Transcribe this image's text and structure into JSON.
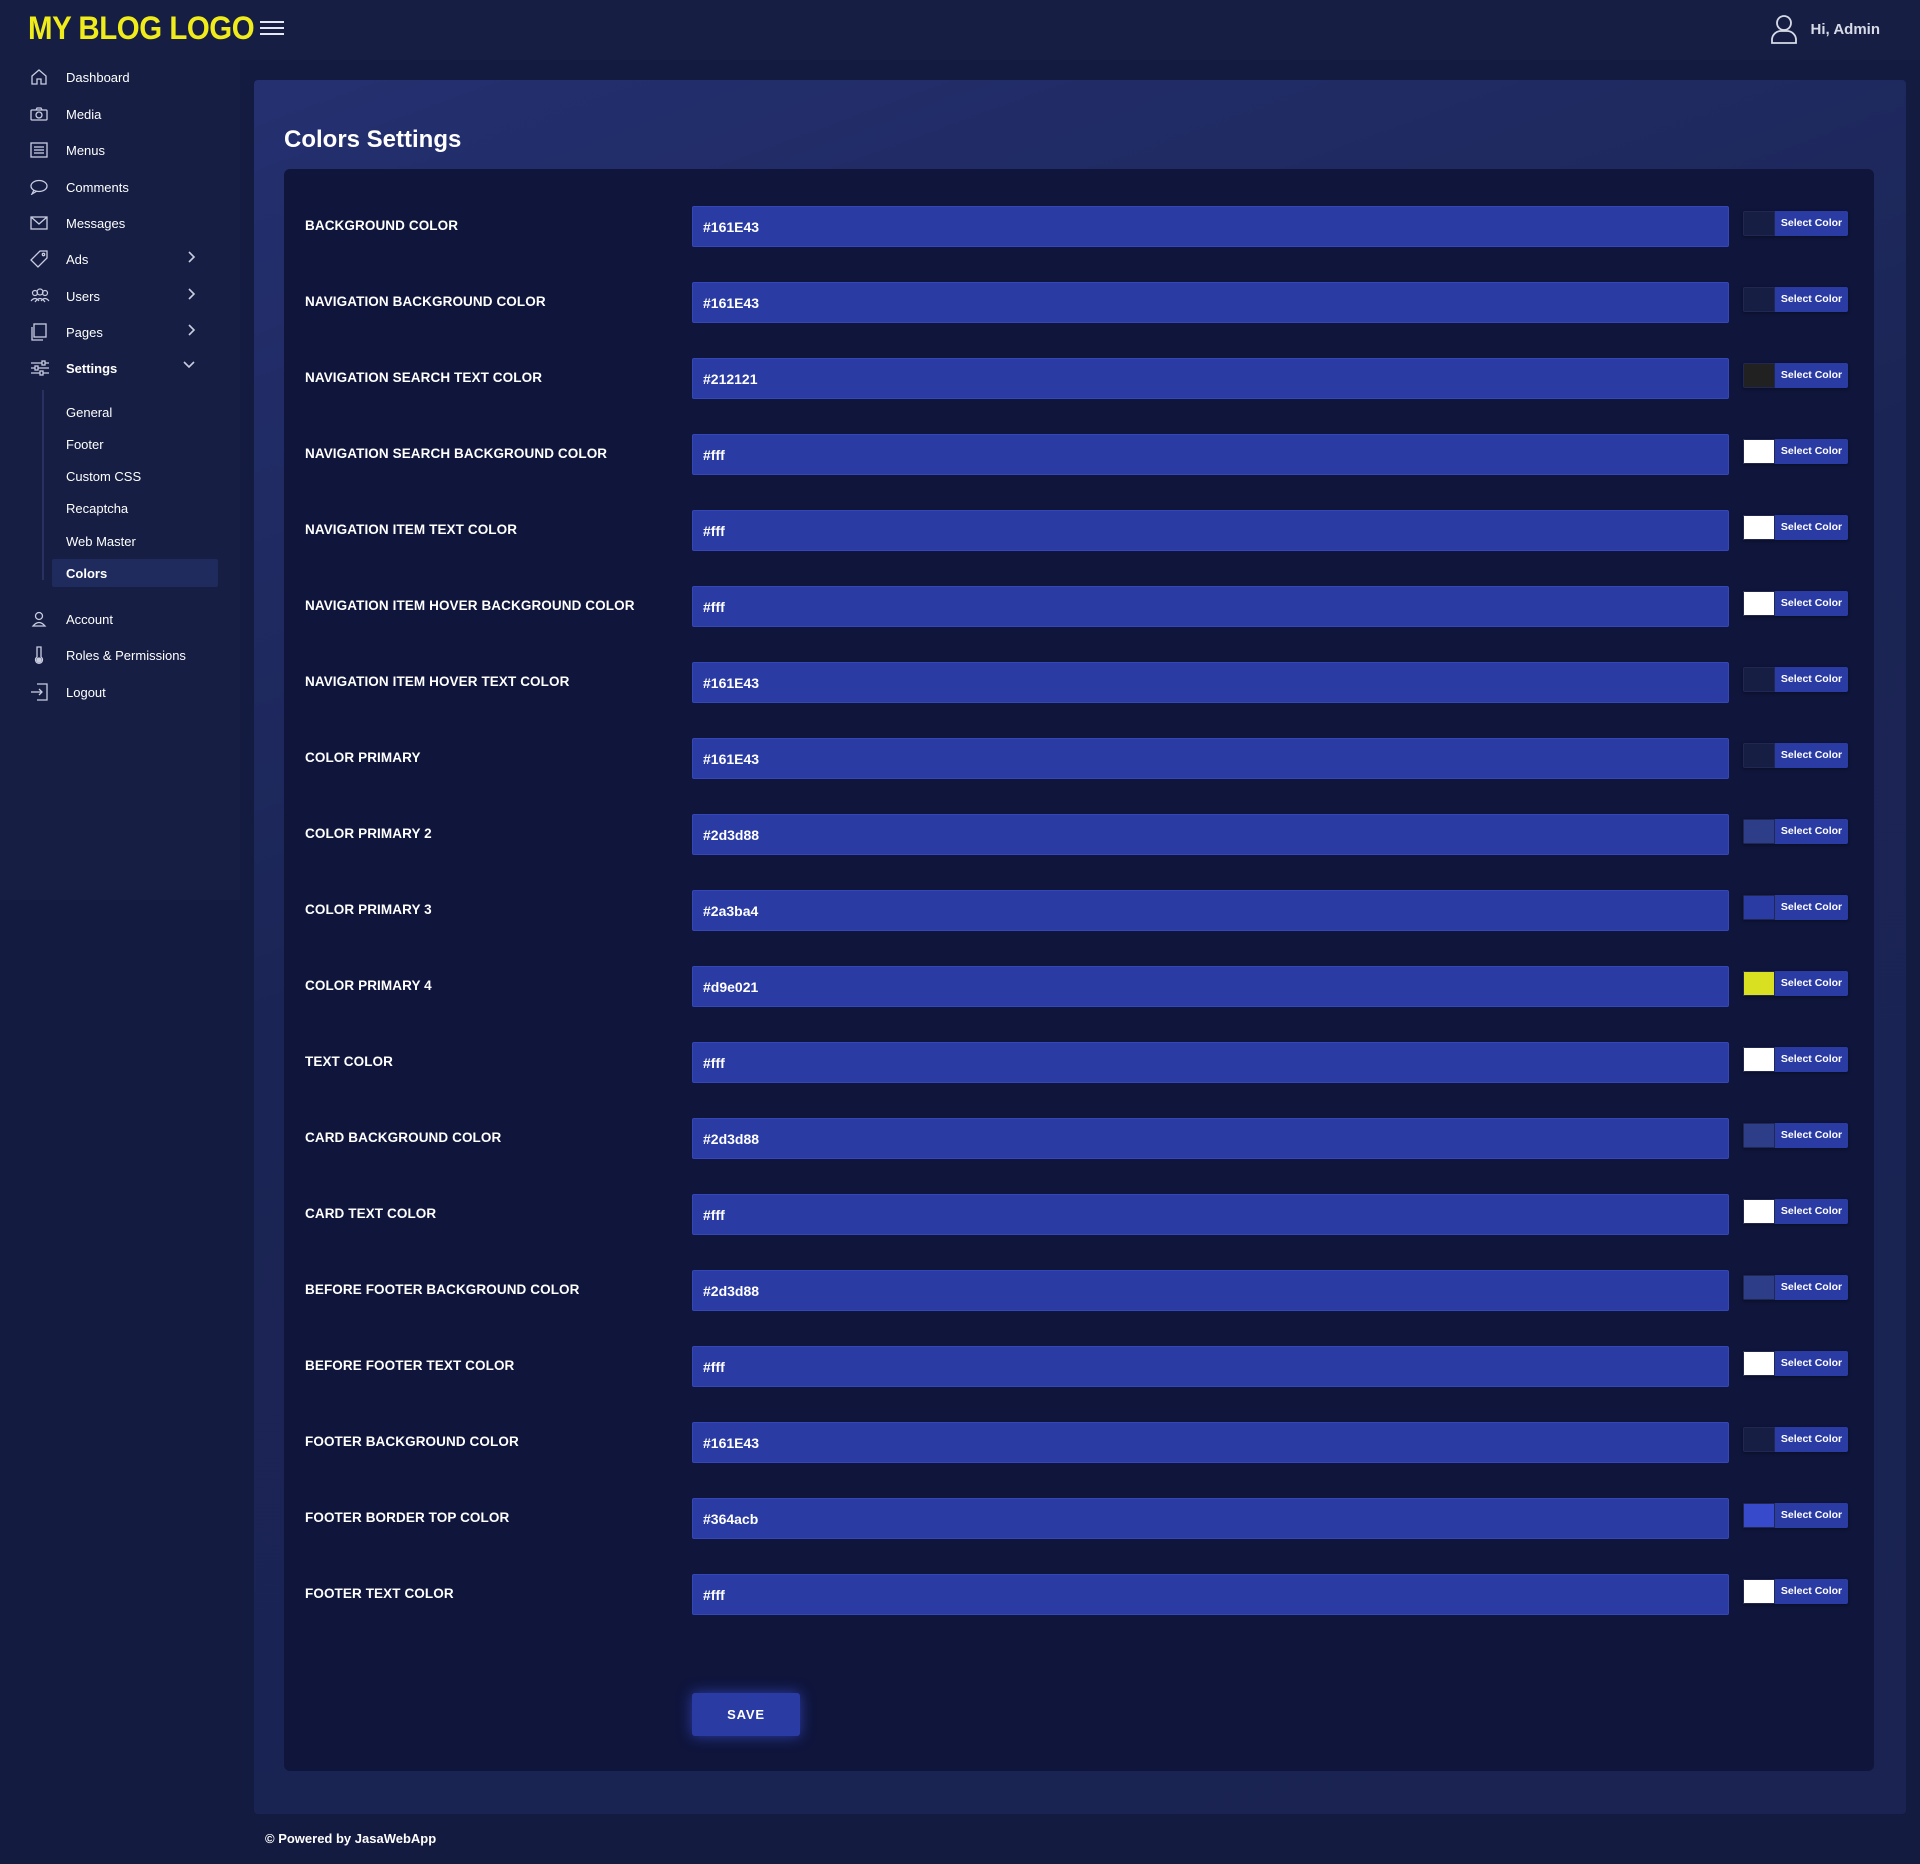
{
  "header": {
    "logo_text": "MY BLOG LOGO",
    "user_greeting": "Hi, Admin",
    "menu_icon": "hamburger-icon",
    "user_icon": "user-icon"
  },
  "sidebar": {
    "items": [
      {
        "label": "Dashboard",
        "icon": "home-icon"
      },
      {
        "label": "Media",
        "icon": "camera-icon"
      },
      {
        "label": "Menus",
        "icon": "list-icon"
      },
      {
        "label": "Comments",
        "icon": "comment-icon"
      },
      {
        "label": "Messages",
        "icon": "mail-icon"
      },
      {
        "label": "Ads",
        "icon": "tag-icon",
        "has_children": true
      },
      {
        "label": "Users",
        "icon": "users-icon",
        "has_children": true
      },
      {
        "label": "Pages",
        "icon": "pages-icon",
        "has_children": true
      },
      {
        "label": "Settings",
        "icon": "sliders-icon",
        "expanded": true
      }
    ],
    "settings_submenu": [
      "General",
      "Footer",
      "Custom CSS",
      "Recaptcha",
      "Web Master",
      "Colors"
    ],
    "active_submenu": "Colors",
    "bottom_items": [
      {
        "label": "Account",
        "icon": "account-icon"
      },
      {
        "label": "Roles & Permissions",
        "icon": "thermometer-icon"
      },
      {
        "label": "Logout",
        "icon": "logout-icon"
      }
    ]
  },
  "main": {
    "title": "Colors Settings",
    "picker_label": "Select Color",
    "save_label": "SAVE",
    "fields": [
      {
        "label": "BACKGROUND COLOR",
        "value": "#161E43",
        "swatch": "#161E43"
      },
      {
        "label": "NAVIGATION BACKGROUND COLOR",
        "value": "#161E43",
        "swatch": "#161E43"
      },
      {
        "label": "NAVIGATION SEARCH TEXT COLOR",
        "value": "#212121",
        "swatch": "#212121"
      },
      {
        "label": "NAVIGATION SEARCH BACKGROUND COLOR",
        "value": "#fff",
        "swatch": "#ffffff"
      },
      {
        "label": "NAVIGATION ITEM TEXT COLOR",
        "value": "#fff",
        "swatch": "#ffffff"
      },
      {
        "label": "NAVIGATION ITEM HOVER BACKGROUND COLOR",
        "value": "#fff",
        "swatch": "#ffffff"
      },
      {
        "label": "NAVIGATION ITEM HOVER TEXT COLOR",
        "value": "#161E43",
        "swatch": "#161E43"
      },
      {
        "label": "COLOR PRIMARY",
        "value": "#161E43",
        "swatch": "#161E43"
      },
      {
        "label": "COLOR PRIMARY 2",
        "value": "#2d3d88",
        "swatch": "#2d3d88"
      },
      {
        "label": "COLOR PRIMARY 3",
        "value": "#2a3ba4",
        "swatch": "#2a3ba4"
      },
      {
        "label": "COLOR PRIMARY 4",
        "value": "#d9e021",
        "swatch": "#d9e021"
      },
      {
        "label": "TEXT COLOR",
        "value": "#fff",
        "swatch": "#ffffff"
      },
      {
        "label": "CARD BACKGROUND COLOR",
        "value": "#2d3d88",
        "swatch": "#2d3d88"
      },
      {
        "label": "CARD TEXT COLOR",
        "value": "#fff",
        "swatch": "#ffffff"
      },
      {
        "label": "BEFORE FOOTER BACKGROUND COLOR",
        "value": "#2d3d88",
        "swatch": "#2d3d88"
      },
      {
        "label": "BEFORE FOOTER TEXT COLOR",
        "value": "#fff",
        "swatch": "#ffffff"
      },
      {
        "label": "FOOTER BACKGROUND COLOR",
        "value": "#161E43",
        "swatch": "#161E43"
      },
      {
        "label": "FOOTER BORDER TOP COLOR",
        "value": "#364acb",
        "swatch": "#364acb"
      },
      {
        "label": "FOOTER TEXT COLOR",
        "value": "#fff",
        "swatch": "#ffffff"
      }
    ]
  },
  "footer": {
    "text": "© Powered by JasaWebApp"
  },
  "colors": {
    "page_bg": "#141b40",
    "topbar_bg": "#161e43",
    "logo": "#f0ec1c",
    "input_bg": "#2a3ba4",
    "card_bg": "#0f153b"
  }
}
